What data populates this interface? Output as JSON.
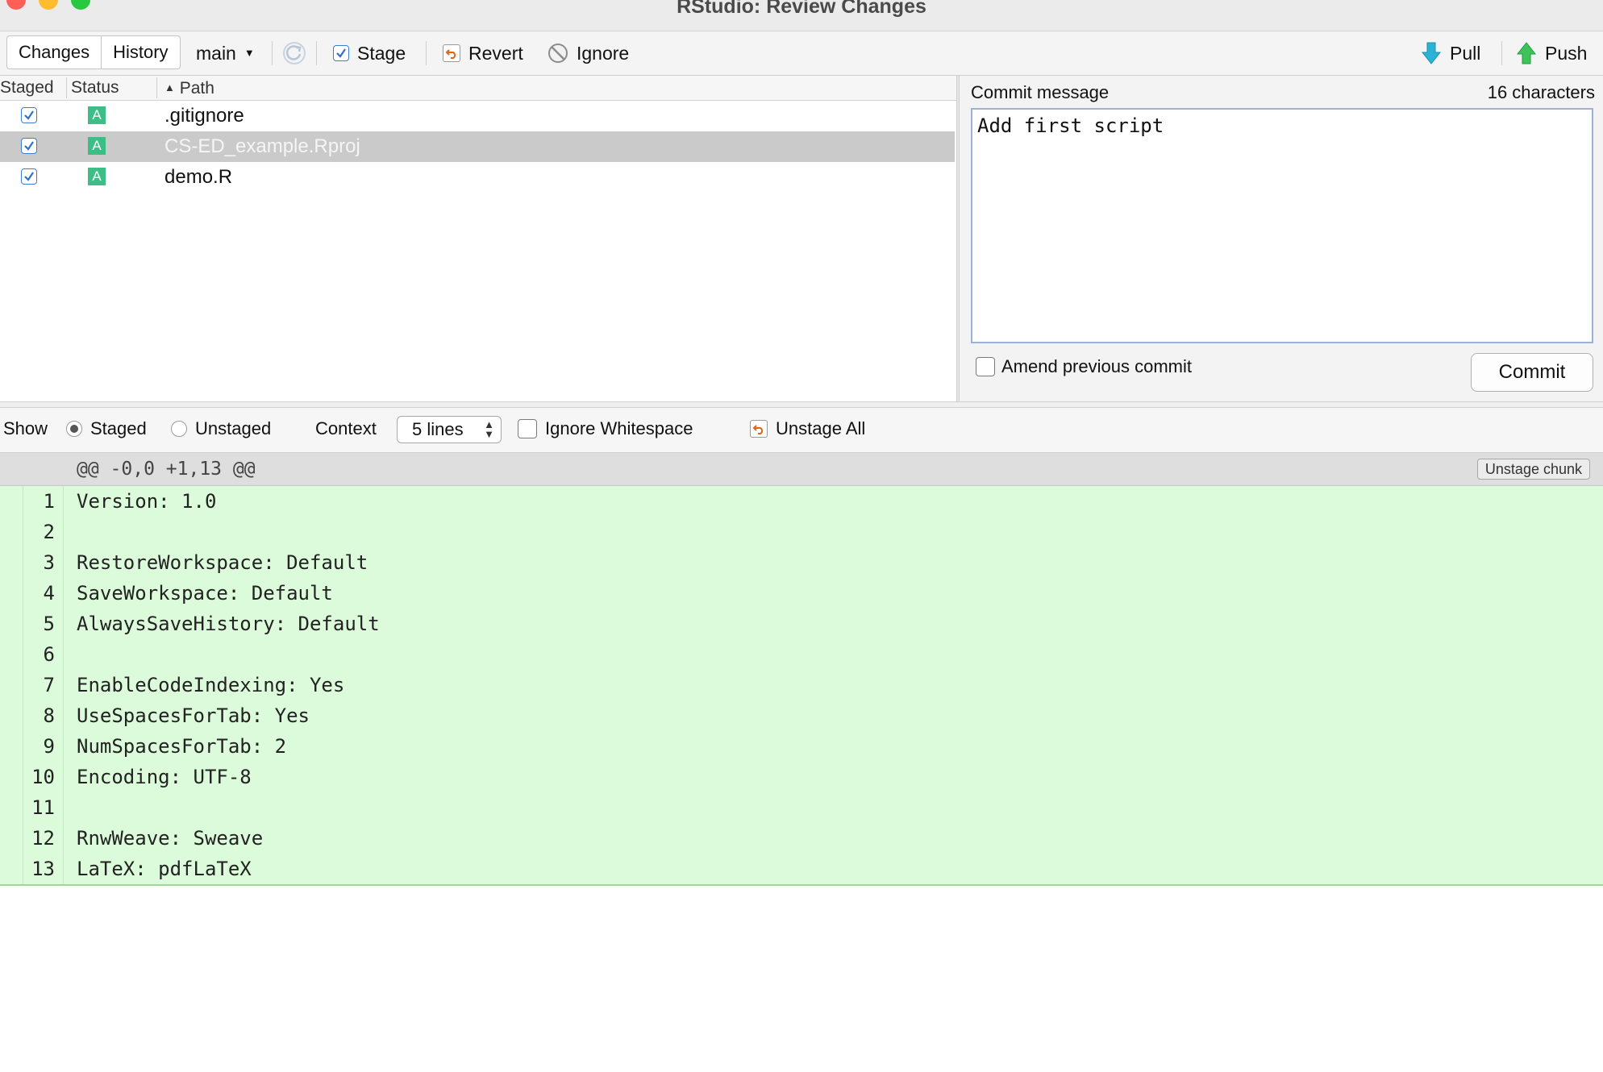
{
  "window": {
    "title": "RStudio: Review Changes",
    "traffic_colors": [
      "#fe5f57",
      "#febc2e",
      "#28c840"
    ]
  },
  "toolbar": {
    "tabs": [
      "Changes",
      "History"
    ],
    "branch": "main",
    "stage_label": "Stage",
    "revert_label": "Revert",
    "ignore_label": "Ignore",
    "pull_label": "Pull",
    "push_label": "Push"
  },
  "file_list": {
    "headers": {
      "staged": "Staged",
      "status": "Status",
      "path": "Path"
    },
    "files": [
      {
        "staged": true,
        "status": "A",
        "path": ".gitignore",
        "selected": false
      },
      {
        "staged": true,
        "status": "A",
        "path": "CS-ED_example.Rproj",
        "selected": true
      },
      {
        "staged": true,
        "status": "A",
        "path": "demo.R",
        "selected": false
      }
    ]
  },
  "commit": {
    "label": "Commit message",
    "char_count": "16 characters",
    "message": "Add first script",
    "amend_label": "Amend previous commit",
    "amend_checked": false,
    "button_label": "Commit"
  },
  "diff_options": {
    "show_label": "Show",
    "staged_label": "Staged",
    "unstaged_label": "Unstaged",
    "show_selected": "Staged",
    "context_label": "Context",
    "context_value": "5 lines",
    "ignore_ws_label": "Ignore Whitespace",
    "ignore_ws_checked": false,
    "unstage_all_label": "Unstage All"
  },
  "diff": {
    "hunk_header": "@@ -0,0 +1,13 @@",
    "unstage_chunk_label": "Unstage chunk",
    "added_color": "#dcfbdb",
    "lines": [
      {
        "num": "1",
        "text": "Version: 1.0"
      },
      {
        "num": "2",
        "text": ""
      },
      {
        "num": "3",
        "text": "RestoreWorkspace: Default"
      },
      {
        "num": "4",
        "text": "SaveWorkspace: Default"
      },
      {
        "num": "5",
        "text": "AlwaysSaveHistory: Default"
      },
      {
        "num": "6",
        "text": ""
      },
      {
        "num": "7",
        "text": "EnableCodeIndexing: Yes"
      },
      {
        "num": "8",
        "text": "UseSpacesForTab: Yes"
      },
      {
        "num": "9",
        "text": "NumSpacesForTab: 2"
      },
      {
        "num": "10",
        "text": "Encoding: UTF-8"
      },
      {
        "num": "11",
        "text": ""
      },
      {
        "num": "12",
        "text": "RnwWeave: Sweave"
      },
      {
        "num": "13",
        "text": "LaTeX: pdfLaTeX"
      }
    ]
  }
}
